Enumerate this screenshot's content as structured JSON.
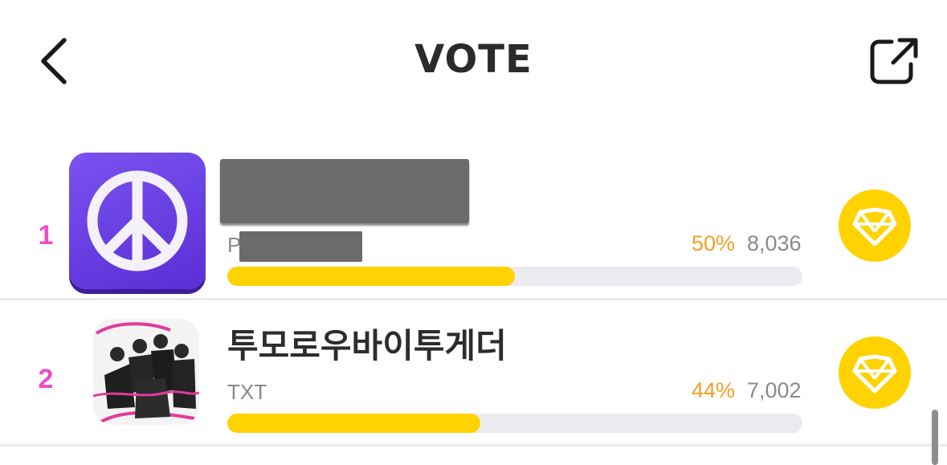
{
  "header": {
    "title": "VOTE",
    "back_icon": "chevron-left-icon",
    "share_icon": "share-external-icon"
  },
  "vote_list": {
    "items": [
      {
        "rank": "1",
        "name": "",
        "name_redacted": true,
        "subtitle_prefix": "P",
        "subtitle_redacted": true,
        "percent": "50%",
        "count": "8,036",
        "bar_fill": 0.5,
        "thumbnail": "peace-sign-icon"
      },
      {
        "rank": "2",
        "name": "투모로우바이투게더",
        "subtitle": "TXT",
        "percent": "44%",
        "count": "7,002",
        "bar_fill": 0.44,
        "thumbnail": "group-photo"
      }
    ],
    "vote_icon": "heart-gem-icon"
  },
  "colors": {
    "accent_yellow": "#ffd200",
    "percent_orange": "#f2a024",
    "rank_pink": "#ea4fc8",
    "track_gray": "#ebebef",
    "purple_tile": "#6a3ee6"
  }
}
